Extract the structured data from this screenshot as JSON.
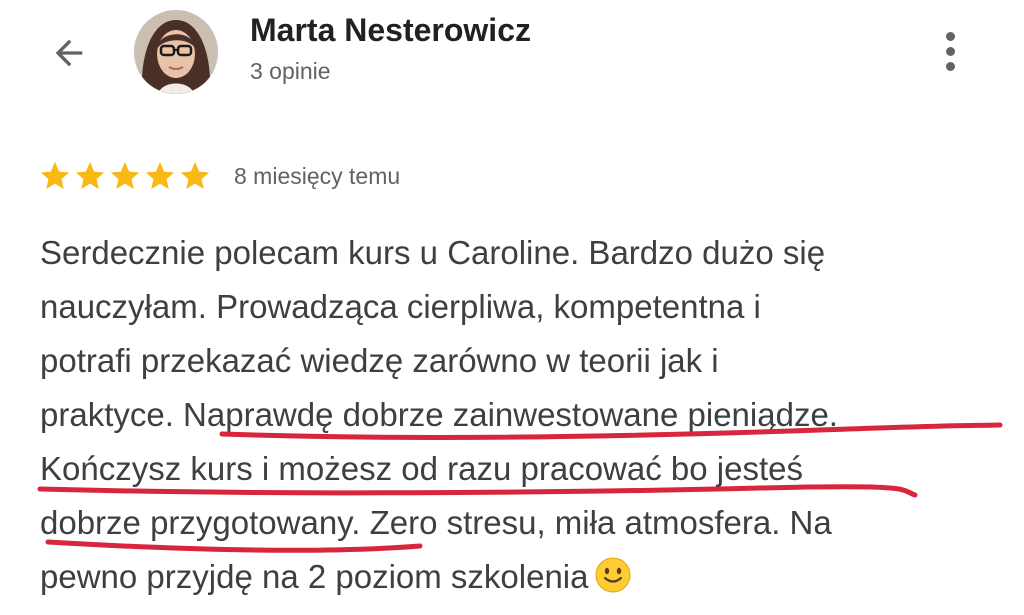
{
  "header": {
    "back_icon": "arrow-back-icon",
    "author_name": "Marta Nesterowicz",
    "review_count": "3 opinie",
    "menu_icon": "more-vertical-icon"
  },
  "rating": {
    "stars": 5,
    "max_stars": 5,
    "star_color": "#f9b915",
    "time_ago": "8 miesięcy temu"
  },
  "review": {
    "lines": [
      "Serdecznie polecam kurs u Caroline. Bardzo dużo się",
      "nauczyłam. Prowadząca cierpliwa, kompetentna i",
      "potrafi przekazać wiedzę zarówno w teorii jak i",
      "praktyce. Naprawdę dobrze zainwestowane pieniądze.",
      "Kończysz kurs i możesz od razu pracować bo jesteś",
      "dobrze przygotowany. Zero stresu, miła atmosfera. Na",
      "pewno przyjdę na 2 poziom szkolenia"
    ],
    "emoji_icon": "slightly-smiling-face-icon",
    "highlight_color": "#d7263d"
  }
}
